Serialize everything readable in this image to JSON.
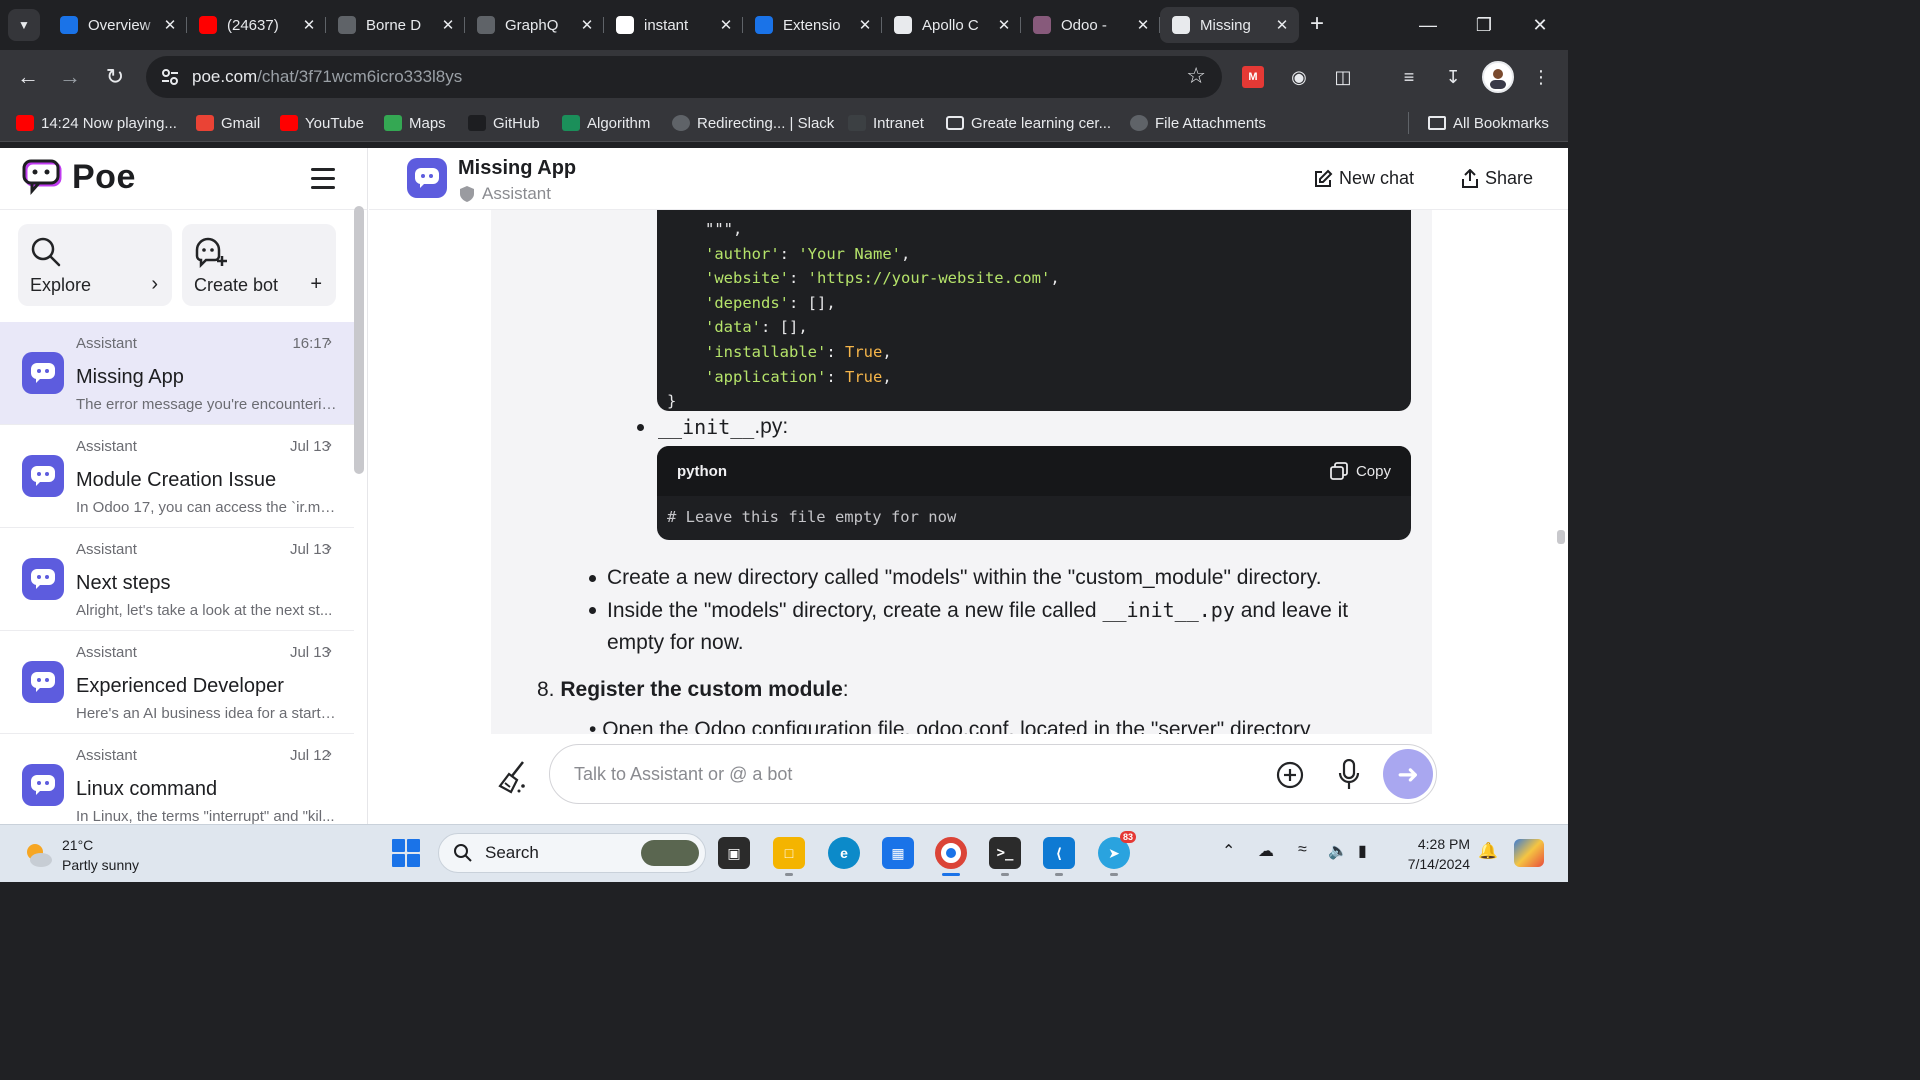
{
  "browser": {
    "tabs": [
      {
        "title": "Overview",
        "icon": "shield-icon",
        "color": "#1a73e8"
      },
      {
        "title": "(24637)",
        "icon": "youtube-icon",
        "color": "#ff0000"
      },
      {
        "title": "Borne D",
        "icon": "globe-icon",
        "color": "#5f6368"
      },
      {
        "title": "GraphQ",
        "icon": "globe-icon",
        "color": "#5f6368"
      },
      {
        "title": "instant",
        "icon": "google-icon",
        "color": "#ffffff"
      },
      {
        "title": "Extensio",
        "icon": "puzzle-icon",
        "color": "#1a73e8"
      },
      {
        "title": "Apollo C",
        "icon": "apollo-icon",
        "color": "#e8eaed"
      },
      {
        "title": "Odoo -",
        "icon": "odoo-icon",
        "color": "#875a7b"
      },
      {
        "title": "Missing",
        "icon": "poe-icon",
        "color": "#e8eaed"
      }
    ],
    "url_domain": "poe.com",
    "url_path": "/chat/3f71wcm6icro333l8ys",
    "bookmarks": [
      {
        "label": "14:24 Now playing...",
        "icon": "youtube-icon"
      },
      {
        "label": "Gmail",
        "icon": "gmail-icon"
      },
      {
        "label": "YouTube",
        "icon": "youtube-icon"
      },
      {
        "label": "Maps",
        "icon": "maps-icon"
      },
      {
        "label": "GitHub",
        "icon": "github-icon"
      },
      {
        "label": "Algorithm",
        "icon": "algorithm-icon"
      },
      {
        "label": "Redirecting... | Slack",
        "icon": "globe-icon"
      },
      {
        "label": "Intranet",
        "icon": "intranet-icon"
      },
      {
        "label": "Greate learning cer...",
        "icon": "folder-icon"
      },
      {
        "label": "File Attachments",
        "icon": "globe-icon"
      }
    ],
    "all_bookmarks": "All Bookmarks"
  },
  "sidebar": {
    "logo": "Poe",
    "explore": "Explore",
    "create_bot": "Create bot",
    "chats": [
      {
        "bot": "Assistant",
        "time": "16:17",
        "title": "Missing App",
        "preview": "The error message you're encounterin..."
      },
      {
        "bot": "Assistant",
        "time": "Jul 13",
        "title": "Module Creation Issue",
        "preview": "In Odoo 17, you can access the `ir.mo..."
      },
      {
        "bot": "Assistant",
        "time": "Jul 13",
        "title": "Next steps",
        "preview": "Alright, let's take a look at the next st..."
      },
      {
        "bot": "Assistant",
        "time": "Jul 13",
        "title": "Experienced Developer",
        "preview": "Here's an AI business idea for a startu..."
      },
      {
        "bot": "Assistant",
        "time": "Jul 12",
        "title": "Linux command",
        "preview": "In Linux, the terms \"interrupt\" and \"kil..."
      }
    ]
  },
  "header": {
    "title": "Missing App",
    "subtitle": "Assistant",
    "new_chat": "New chat",
    "share": "Share"
  },
  "message": {
    "code1": [
      "\"\"\",",
      {
        "k": "'author'",
        "v": "'Your Name'",
        "t": "str"
      },
      {
        "k": "'website'",
        "v": "'https://your-website.com'",
        "t": "str"
      },
      {
        "k": "'depends'",
        "v": "[]",
        "t": "plain"
      },
      {
        "k": "'data'",
        "v": "[]",
        "t": "plain"
      },
      {
        "k": "'installable'",
        "v": "True",
        "t": "bool"
      },
      {
        "k": "'application'",
        "v": "True",
        "t": "bool"
      },
      "}"
    ],
    "init_file": "__init__",
    "init_ext": ".py:",
    "code2_lang": "python",
    "code2_copy": "Copy",
    "code2_body": "# Leave this file empty for now",
    "bullets": [
      "Create a new directory called \"models\" within the \"custom_module\" directory.",
      "Inside the \"models\" directory, create a new file called __init__.py and leave it empty for now."
    ],
    "step_num": "8.",
    "step_title": "Register the custom module",
    "step_colon": ":",
    "cut_line": "Open the Odoo configuration file, odoo.conf, located in the \"server\" directory"
  },
  "composer": {
    "placeholder": "Talk to Assistant or @ a bot"
  },
  "taskbar": {
    "temp": "21°C",
    "weather": "Partly sunny",
    "search": "Search",
    "time": "4:28 PM",
    "date": "7/14/2024",
    "telegram_badge": "83"
  }
}
